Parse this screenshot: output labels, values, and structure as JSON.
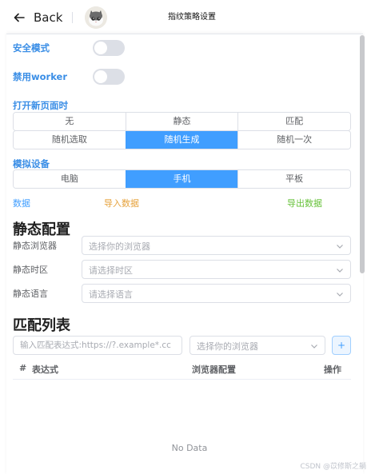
{
  "header": {
    "back_label": "Back",
    "title": "指纹策略设置"
  },
  "switches": {
    "safe_mode": {
      "label": "安全模式",
      "on": false
    },
    "disable_worker": {
      "label": "禁用worker",
      "on": false
    }
  },
  "open_new_page": {
    "label": "打开新页面时",
    "options_row1": [
      "无",
      "静态",
      "匹配"
    ],
    "options_row2": [
      "随机选取",
      "随机生成",
      "随机一次"
    ],
    "selected": "随机生成"
  },
  "device": {
    "label": "模拟设备",
    "options": [
      "电脑",
      "手机",
      "平板"
    ],
    "selected": "手机"
  },
  "data_row": {
    "label": "数据",
    "import_label": "导入数据",
    "export_label": "导出数据"
  },
  "static_config": {
    "heading": "静态配置",
    "fields": [
      {
        "label": "静态浏览器",
        "placeholder": "选择你的浏览器"
      },
      {
        "label": "静态时区",
        "placeholder": "请选择时区"
      },
      {
        "label": "静态语言",
        "placeholder": "请选择语言"
      }
    ]
  },
  "match_list": {
    "heading": "匹配列表",
    "input_placeholder": "输入匹配表达式:https://?.example*.cc",
    "select_placeholder": "选择你的浏览器",
    "add_label": "+",
    "columns": [
      "#",
      "表达式",
      "浏览器配置",
      "操作"
    ],
    "empty_text": "No Data"
  },
  "watermark": "CSDN @苡修斯之躺",
  "colors": {
    "primary": "#409eff",
    "label_blue": "#3a8ee6",
    "import_orange": "#e6a23c",
    "export_green": "#67c23a"
  }
}
